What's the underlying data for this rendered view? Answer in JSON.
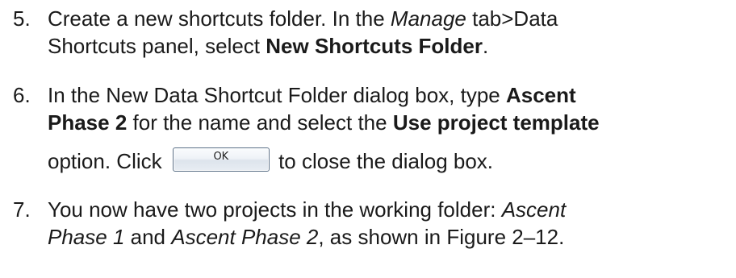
{
  "steps": [
    {
      "number": "5.",
      "line1_a": "Create a new shortcuts folder. In the ",
      "line1_b": "Manage",
      "line1_c": " tab>Data",
      "line2_a": "Shortcuts panel, select ",
      "line2_b": "New Shortcuts Folder",
      "line2_c": "."
    },
    {
      "number": "6.",
      "line1_a": "In the New Data Shortcut Folder dialog box, type ",
      "line1_b": "Ascent",
      "line2_a": "Phase 2",
      "line2_b": " for the name and select the ",
      "line2_c": "Use project template",
      "line3_a": "option. Click ",
      "ok_label": "OK",
      "line3_b": " to close the dialog box."
    },
    {
      "number": "7.",
      "line1_a": "You now have two projects in the working folder: ",
      "line1_b": "Ascent",
      "line2_a": "Phase 1",
      "line2_b": " and ",
      "line2_c": "Ascent Phase 2",
      "line2_d": ", as shown in Figure 2–12."
    }
  ]
}
